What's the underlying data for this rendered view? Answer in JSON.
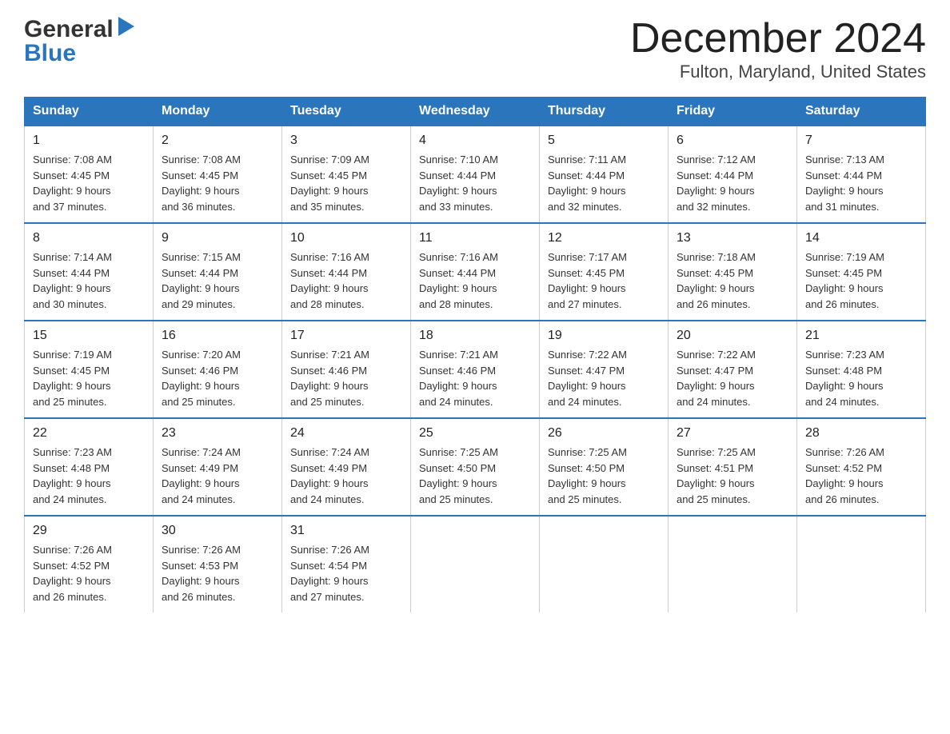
{
  "logo": {
    "general": "General",
    "blue": "Blue"
  },
  "title": "December 2024",
  "subtitle": "Fulton, Maryland, United States",
  "days_of_week": [
    "Sunday",
    "Monday",
    "Tuesday",
    "Wednesday",
    "Thursday",
    "Friday",
    "Saturday"
  ],
  "weeks": [
    [
      {
        "num": "1",
        "sunrise": "7:08 AM",
        "sunset": "4:45 PM",
        "daylight": "9 hours and 37 minutes."
      },
      {
        "num": "2",
        "sunrise": "7:08 AM",
        "sunset": "4:45 PM",
        "daylight": "9 hours and 36 minutes."
      },
      {
        "num": "3",
        "sunrise": "7:09 AM",
        "sunset": "4:45 PM",
        "daylight": "9 hours and 35 minutes."
      },
      {
        "num": "4",
        "sunrise": "7:10 AM",
        "sunset": "4:44 PM",
        "daylight": "9 hours and 33 minutes."
      },
      {
        "num": "5",
        "sunrise": "7:11 AM",
        "sunset": "4:44 PM",
        "daylight": "9 hours and 32 minutes."
      },
      {
        "num": "6",
        "sunrise": "7:12 AM",
        "sunset": "4:44 PM",
        "daylight": "9 hours and 32 minutes."
      },
      {
        "num": "7",
        "sunrise": "7:13 AM",
        "sunset": "4:44 PM",
        "daylight": "9 hours and 31 minutes."
      }
    ],
    [
      {
        "num": "8",
        "sunrise": "7:14 AM",
        "sunset": "4:44 PM",
        "daylight": "9 hours and 30 minutes."
      },
      {
        "num": "9",
        "sunrise": "7:15 AM",
        "sunset": "4:44 PM",
        "daylight": "9 hours and 29 minutes."
      },
      {
        "num": "10",
        "sunrise": "7:16 AM",
        "sunset": "4:44 PM",
        "daylight": "9 hours and 28 minutes."
      },
      {
        "num": "11",
        "sunrise": "7:16 AM",
        "sunset": "4:44 PM",
        "daylight": "9 hours and 28 minutes."
      },
      {
        "num": "12",
        "sunrise": "7:17 AM",
        "sunset": "4:45 PM",
        "daylight": "9 hours and 27 minutes."
      },
      {
        "num": "13",
        "sunrise": "7:18 AM",
        "sunset": "4:45 PM",
        "daylight": "9 hours and 26 minutes."
      },
      {
        "num": "14",
        "sunrise": "7:19 AM",
        "sunset": "4:45 PM",
        "daylight": "9 hours and 26 minutes."
      }
    ],
    [
      {
        "num": "15",
        "sunrise": "7:19 AM",
        "sunset": "4:45 PM",
        "daylight": "9 hours and 25 minutes."
      },
      {
        "num": "16",
        "sunrise": "7:20 AM",
        "sunset": "4:46 PM",
        "daylight": "9 hours and 25 minutes."
      },
      {
        "num": "17",
        "sunrise": "7:21 AM",
        "sunset": "4:46 PM",
        "daylight": "9 hours and 25 minutes."
      },
      {
        "num": "18",
        "sunrise": "7:21 AM",
        "sunset": "4:46 PM",
        "daylight": "9 hours and 24 minutes."
      },
      {
        "num": "19",
        "sunrise": "7:22 AM",
        "sunset": "4:47 PM",
        "daylight": "9 hours and 24 minutes."
      },
      {
        "num": "20",
        "sunrise": "7:22 AM",
        "sunset": "4:47 PM",
        "daylight": "9 hours and 24 minutes."
      },
      {
        "num": "21",
        "sunrise": "7:23 AM",
        "sunset": "4:48 PM",
        "daylight": "9 hours and 24 minutes."
      }
    ],
    [
      {
        "num": "22",
        "sunrise": "7:23 AM",
        "sunset": "4:48 PM",
        "daylight": "9 hours and 24 minutes."
      },
      {
        "num": "23",
        "sunrise": "7:24 AM",
        "sunset": "4:49 PM",
        "daylight": "9 hours and 24 minutes."
      },
      {
        "num": "24",
        "sunrise": "7:24 AM",
        "sunset": "4:49 PM",
        "daylight": "9 hours and 24 minutes."
      },
      {
        "num": "25",
        "sunrise": "7:25 AM",
        "sunset": "4:50 PM",
        "daylight": "9 hours and 25 minutes."
      },
      {
        "num": "26",
        "sunrise": "7:25 AM",
        "sunset": "4:50 PM",
        "daylight": "9 hours and 25 minutes."
      },
      {
        "num": "27",
        "sunrise": "7:25 AM",
        "sunset": "4:51 PM",
        "daylight": "9 hours and 25 minutes."
      },
      {
        "num": "28",
        "sunrise": "7:26 AM",
        "sunset": "4:52 PM",
        "daylight": "9 hours and 26 minutes."
      }
    ],
    [
      {
        "num": "29",
        "sunrise": "7:26 AM",
        "sunset": "4:52 PM",
        "daylight": "9 hours and 26 minutes."
      },
      {
        "num": "30",
        "sunrise": "7:26 AM",
        "sunset": "4:53 PM",
        "daylight": "9 hours and 26 minutes."
      },
      {
        "num": "31",
        "sunrise": "7:26 AM",
        "sunset": "4:54 PM",
        "daylight": "9 hours and 27 minutes."
      },
      null,
      null,
      null,
      null
    ]
  ],
  "labels": {
    "sunrise": "Sunrise:",
    "sunset": "Sunset:",
    "daylight": "Daylight:"
  }
}
